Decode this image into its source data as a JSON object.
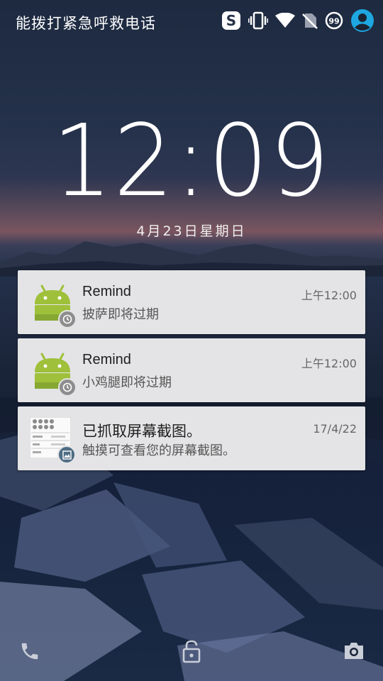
{
  "status_bar": {
    "carrier_text": "能拨打紧急呼救电话",
    "icons": [
      "sogou-icon",
      "vibrate-icon",
      "wifi-icon",
      "no-sim-icon",
      "battery-icon",
      "user-avatar-icon"
    ],
    "battery_level": "99"
  },
  "lockscreen": {
    "time": "12:09",
    "date": "4月23日星期日"
  },
  "notifications": [
    {
      "app_icon": "android-icon",
      "badge_icon": "clock-icon",
      "title": "Remind",
      "text": "披萨即将过期",
      "time": "上午12:00"
    },
    {
      "app_icon": "android-icon",
      "badge_icon": "clock-icon",
      "title": "Remind",
      "text": "小鸡腿即将过期",
      "time": "上午12:00"
    },
    {
      "app_icon": "screenshot-thumbnail",
      "badge_icon": "image-icon",
      "title": "已抓取屏幕截图。",
      "text": "触摸可查看您的屏幕截图。",
      "time": "17/4/22"
    }
  ],
  "bottom_actions": [
    "phone-icon",
    "unlock-icon",
    "camera-icon"
  ],
  "colors": {
    "android_green": "#9fc03a",
    "card_bg": "#e4e4e6",
    "accent_blue": "#1ea7e1"
  }
}
